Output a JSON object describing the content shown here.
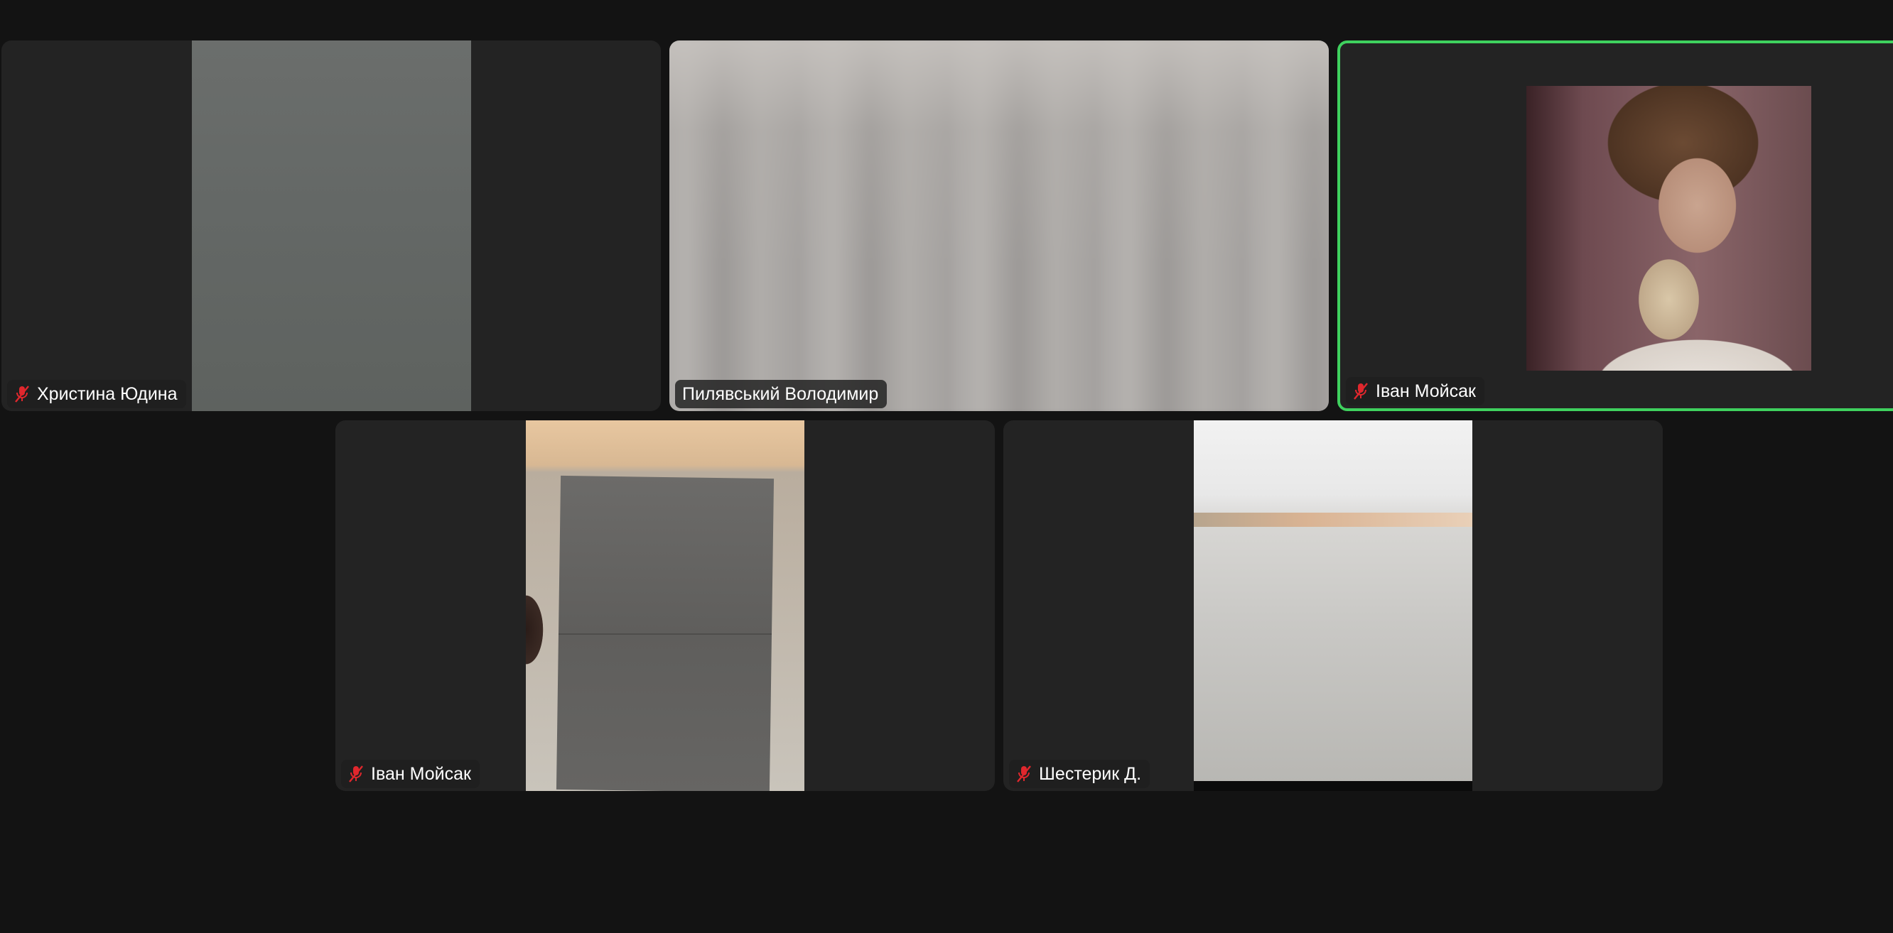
{
  "participants": [
    {
      "name": "Христина Юдина",
      "muted": true,
      "active": false
    },
    {
      "name": "Пилявський Володимир",
      "muted": false,
      "active": false
    },
    {
      "name": "Іван Мойсак",
      "muted": true,
      "active": true
    },
    {
      "name": "Іван Мойсак",
      "muted": true,
      "active": false
    },
    {
      "name": "Шестерик Д.",
      "muted": true,
      "active": false
    }
  ],
  "colors": {
    "background": "#131313",
    "tile": "#232323",
    "active_border": "#3fd15e",
    "muted_icon": "#e0272d",
    "name_text": "#ffffff"
  },
  "icons": {
    "muted": "microphone-muted-icon"
  }
}
